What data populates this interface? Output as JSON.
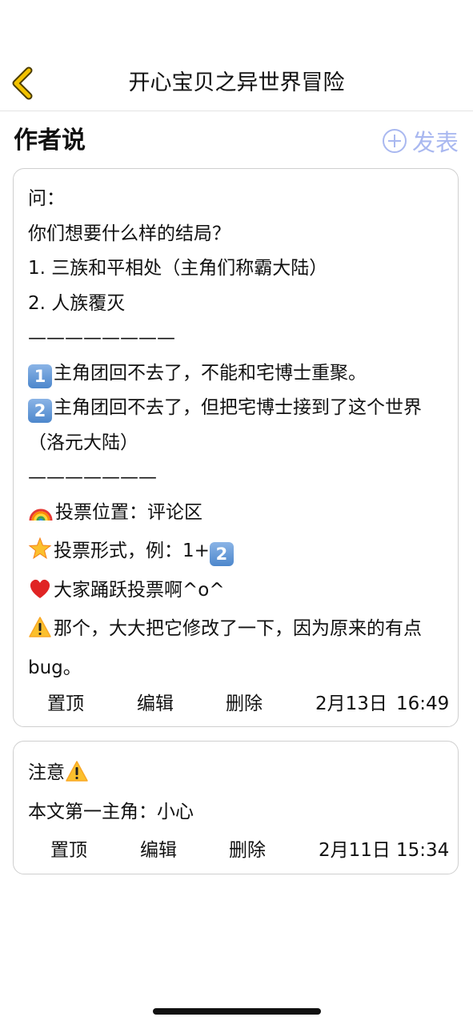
{
  "header": {
    "title": "开心宝贝之异世界冒险",
    "back_icon": "chevron-left-icon",
    "back_color": "#f2c200"
  },
  "section": {
    "title": "作者说",
    "publish_label": "发表",
    "publish_color": "#a9b8f0"
  },
  "notes": [
    {
      "lines": [
        "问：",
        "你们想要什么样的结局？",
        "1.  三族和平相处（主角们称霸大陆）",
        "2.  人族覆灭",
        "————————",
        "主角团回不去了，不能和宅博士重聚。",
        "主角团回不去了，但把宅博士接到了这个世界（洛元大陆）",
        "———————",
        "投票位置：评论区",
        "投票形式，例：1+",
        "大家踊跃投票啊^o^",
        "那个，大大把它修改了一下，因为原来的有点bug。"
      ],
      "keycaps": [
        "1",
        "2",
        "2"
      ],
      "emoji_names": [
        "rainbow-icon",
        "glowing-star-icon",
        "red-heart-icon",
        "warning-icon"
      ],
      "actions": {
        "pin": "置顶",
        "edit": "编辑",
        "delete": "删除"
      },
      "date": "2月13日",
      "time": "16:49"
    },
    {
      "lines": [
        "注意",
        "本文第一主角：小心"
      ],
      "emoji_names": [
        "warning-icon"
      ],
      "actions": {
        "pin": "置顶",
        "edit": "编辑",
        "delete": "删除"
      },
      "date": "2月11日",
      "time": "15:34"
    }
  ]
}
